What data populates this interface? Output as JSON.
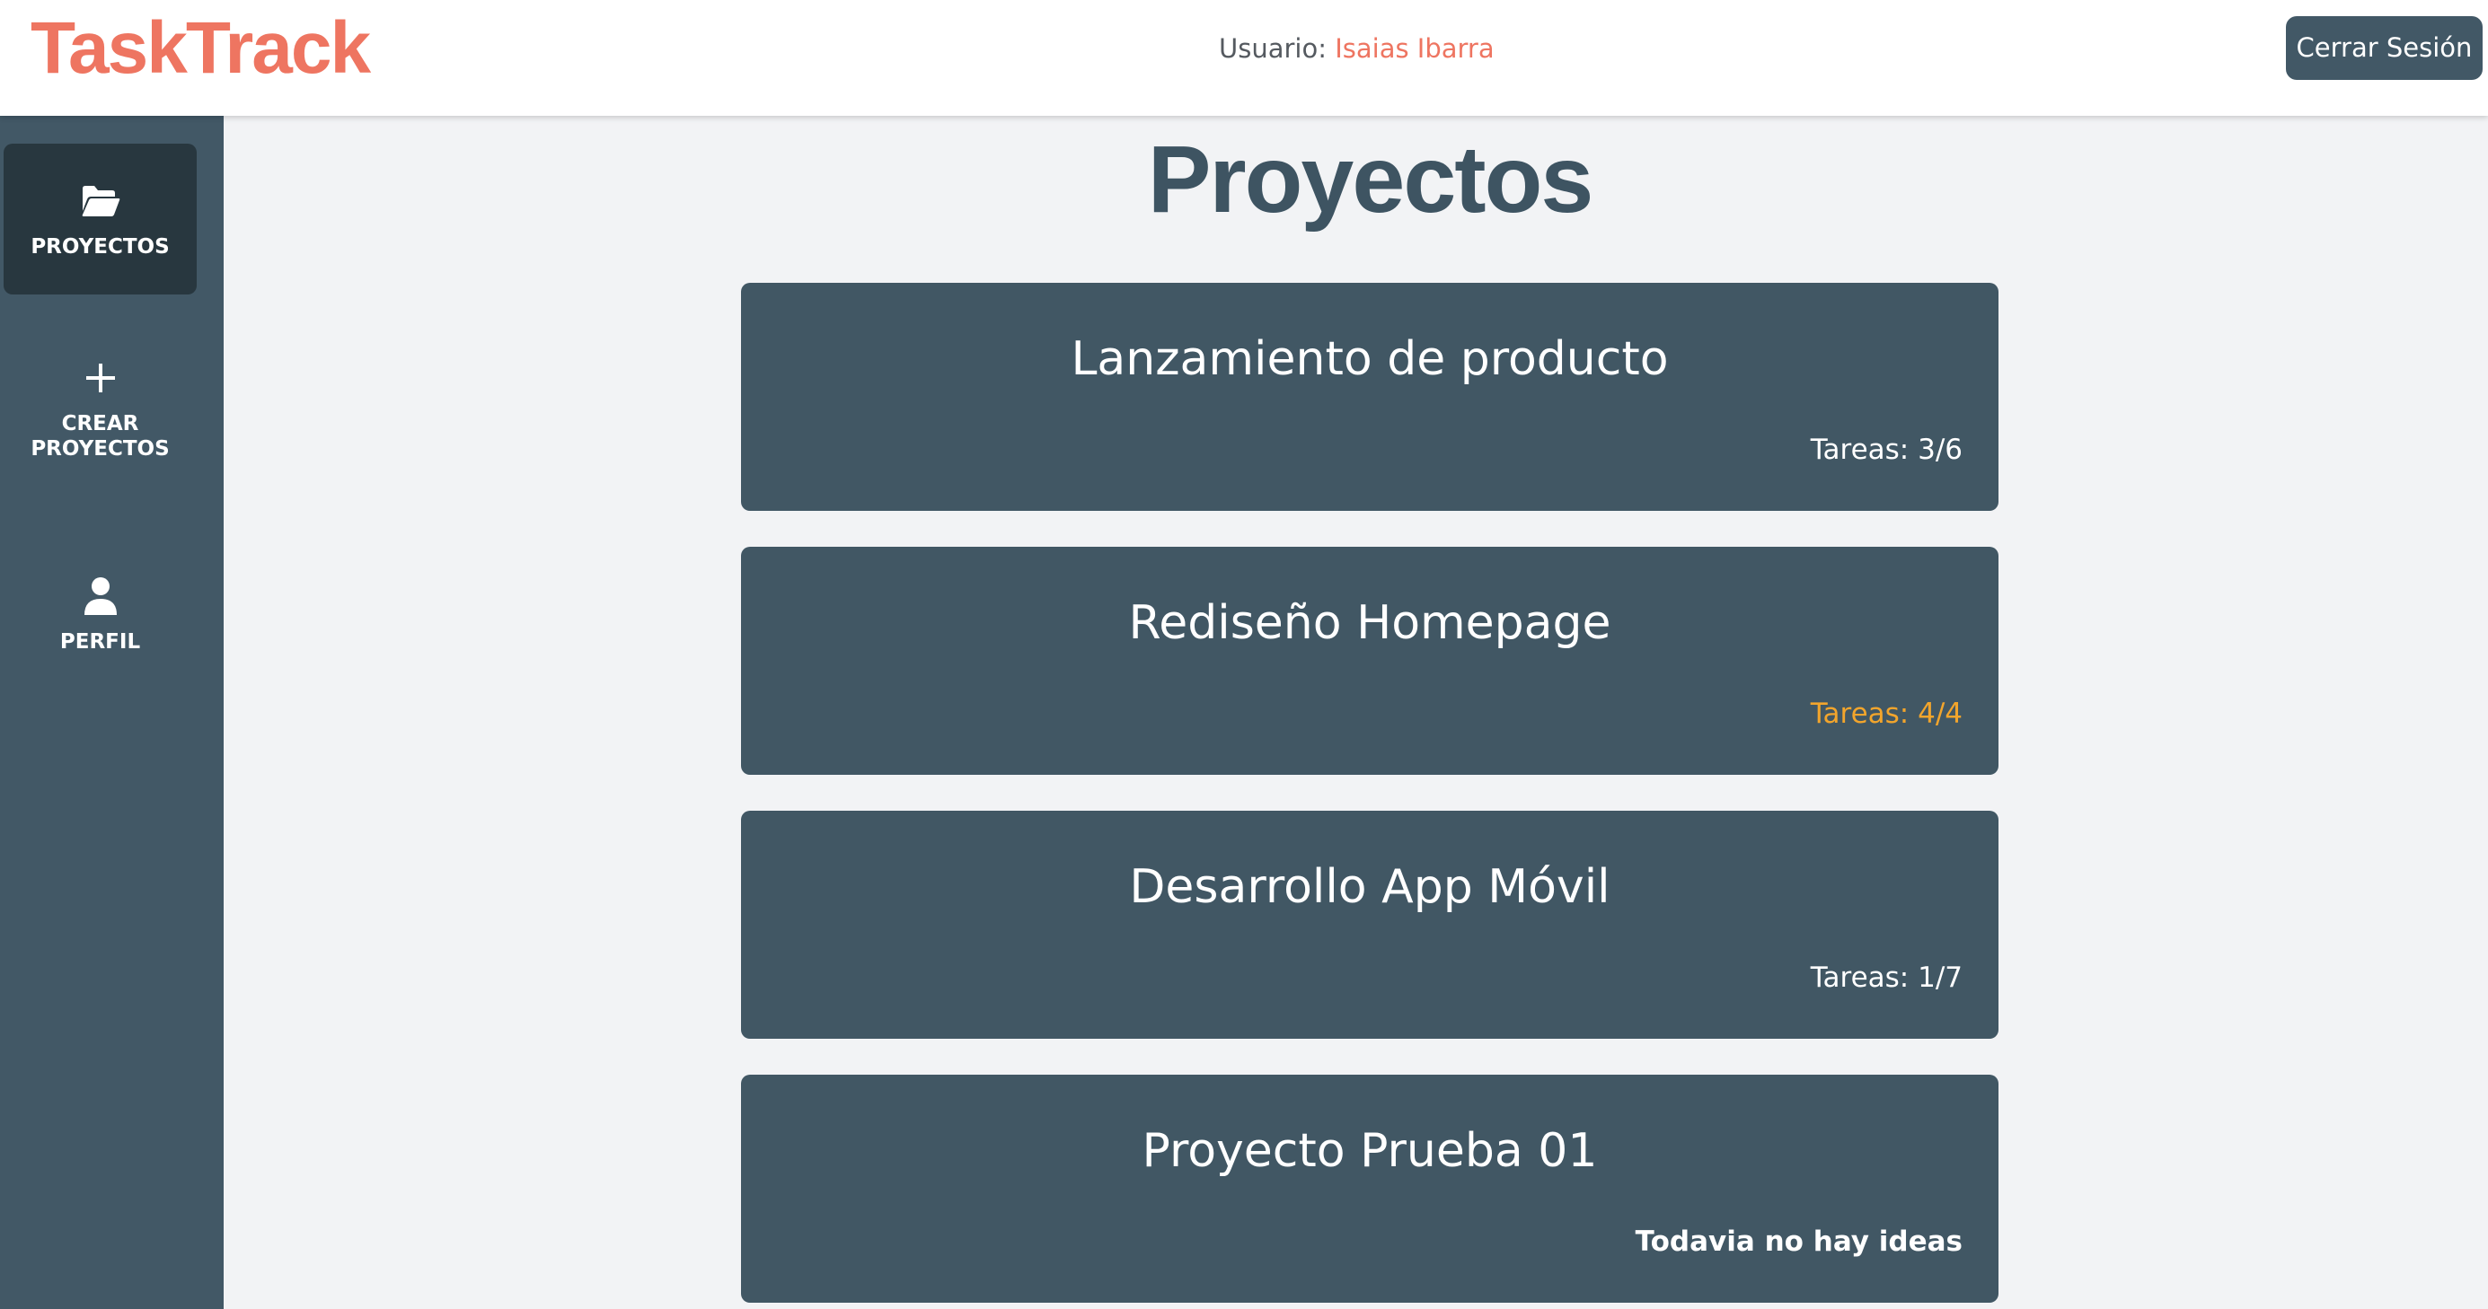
{
  "header": {
    "logo": "TaskTrack",
    "user_label": "Usuario:",
    "user_name": "Isaias Ibarra",
    "logout_label": "Cerrar Sesión"
  },
  "sidebar": {
    "items": [
      {
        "label": "PROYECTOS",
        "icon": "folder-open-icon",
        "active": true
      },
      {
        "label": "CREAR\nPROYECTOS",
        "icon": "plus-icon",
        "active": false
      },
      {
        "label": "PERFIL",
        "icon": "user-icon",
        "active": false
      }
    ]
  },
  "main": {
    "title": "Proyectos",
    "projects": [
      {
        "name": "Lanzamiento de producto",
        "tasks": "Tareas: 3/6"
      },
      {
        "name": "Rediseño Homepage",
        "tasks": "Tareas: 4/4"
      },
      {
        "name": "Desarrollo App Móvil",
        "tasks": "Tareas: 1/7"
      },
      {
        "name": "Proyecto Prueba 01",
        "tasks": "Todavia no hay ideas"
      }
    ]
  },
  "colors": {
    "brand": "#ee7561",
    "sidebar_bg": "#425866",
    "sidebar_active": "#28373f",
    "card_bg": "#415764",
    "complete": "#f2a52c",
    "page_bg": "#f2f3f5"
  }
}
